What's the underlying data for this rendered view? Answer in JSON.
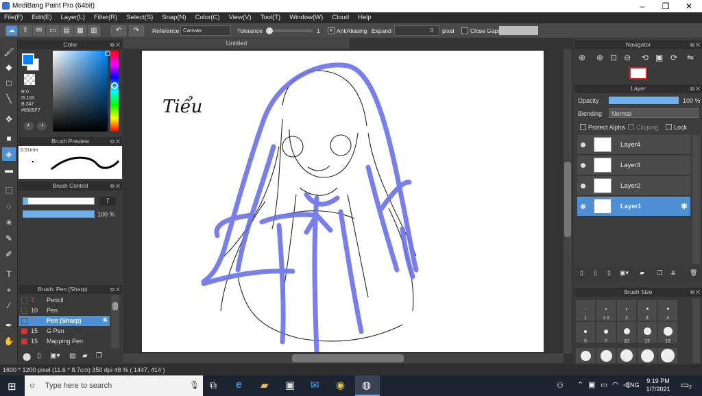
{
  "app": {
    "title": "MediBang Paint Pro (64bit)"
  },
  "window_controls": {
    "minimize": "–",
    "maximize": "❐",
    "close": "✕"
  },
  "menu": [
    "File(F)",
    "Edit(E)",
    "Layer(L)",
    "Filter(R)",
    "Select(S)",
    "Snap(N)",
    "Color(C)",
    "View(V)",
    "Tool(T)",
    "Window(W)",
    "Cloud",
    "Help"
  ],
  "toolbar": {
    "reference_label": "Reference",
    "reference_value": "Canvas",
    "tolerance_label": "Tolerance",
    "tolerance_value": "1",
    "tolerance_level": 0.0,
    "antialiasing_label": "AntiAliasing",
    "antialiasing_checked": true,
    "expand_label": "Expand",
    "expand_value": "0",
    "expand_unit": "pixel",
    "closegaps_label": "Close Gaps",
    "closegaps_checked": false
  },
  "color_panel": {
    "title": "Color",
    "r": "R:0",
    "g": "G:133",
    "b": "B:247",
    "hex": "#0085F7",
    "primary": "#0085F7",
    "accent": "#4d90d6"
  },
  "brush_preview": {
    "title": "Brush Preview",
    "size": "0.51mm"
  },
  "brush_control": {
    "title": "Brush Control",
    "size_value": "7",
    "opacity_value": "100 %",
    "size_level": 0.07,
    "opacity_level": 1.0
  },
  "brush_list": {
    "title": "Brush: Pen (Sharp)",
    "items": [
      {
        "size": "7",
        "name": "Pencil",
        "color": "#2a2a2a"
      },
      {
        "size": "10",
        "name": "Pen",
        "color": "#2a2a2a"
      },
      {
        "size": "7",
        "name": "Pen (Sharp)",
        "color": "#2a2a2a",
        "selected": true
      },
      {
        "size": "15",
        "name": "G Pen",
        "color": "#e03030"
      },
      {
        "size": "15",
        "name": "Mapping Pen",
        "color": "#e03030"
      }
    ]
  },
  "document": {
    "tab": "Untitled",
    "signature": "Tiểu"
  },
  "navigator": {
    "title": "Navigator"
  },
  "layer_panel": {
    "title": "Layer",
    "opacity_label": "Opacity",
    "opacity_value": "100 %",
    "blending_label": "Blending",
    "blending_value": "Normal",
    "protect_alpha": "Protect Alpha",
    "clipping": "Clipping",
    "lock": "Lock",
    "layers": [
      "Layer4",
      "Layer3",
      "Layer2",
      "Layer1"
    ],
    "selected_layer": "Layer1"
  },
  "brush_size": {
    "title": "Brush Size",
    "row1": [
      "",
      ".",
      ".",
      ".",
      "."
    ],
    "labels1": [
      "1",
      "1.5",
      "2",
      "3",
      "4"
    ],
    "labels2": [
      "5",
      "7",
      "10",
      "12",
      "15"
    ]
  },
  "statusbar": {
    "text": "1600 * 1200 pixel   (11.6 * 8.7cm)   350 dpi   48 %   ( 1447, 414 )"
  },
  "taskbar": {
    "search_placeholder": "Type here to search",
    "time": "9:19 PM",
    "date": "1/7/2021",
    "lang": "ENG",
    "notif_count": "2"
  }
}
